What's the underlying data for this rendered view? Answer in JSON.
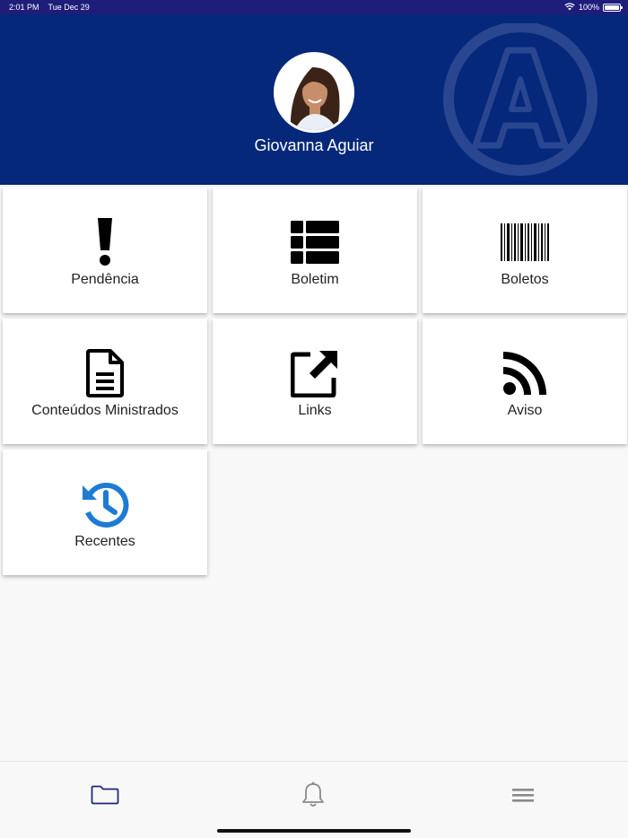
{
  "status_bar": {
    "time": "2:01 PM",
    "date": "Tue Dec 29",
    "battery": "100%",
    "battery_level": 1.0
  },
  "profile": {
    "name": "Giovanna Aguiar"
  },
  "tiles": [
    {
      "label": "Pendência",
      "icon": "exclamation-icon"
    },
    {
      "label": "Boletim",
      "icon": "table-list-icon"
    },
    {
      "label": "Boletos",
      "icon": "barcode-icon"
    },
    {
      "label": "Conteúdos Ministrados",
      "icon": "document-icon"
    },
    {
      "label": "Links",
      "icon": "external-link-icon"
    },
    {
      "label": "Aviso",
      "icon": "rss-icon"
    },
    {
      "label": "Recentes",
      "icon": "history-icon"
    }
  ],
  "tabbar": {
    "items": [
      "folder-icon",
      "bell-icon",
      "menu-icon"
    ],
    "active": "folder-icon"
  },
  "colors": {
    "header": "#05287a",
    "status_bar": "#1f1d7a",
    "accent_blue": "#1e7bd4",
    "tab_active": "#1f2a7a",
    "tab_inactive": "#8a8a8a"
  }
}
